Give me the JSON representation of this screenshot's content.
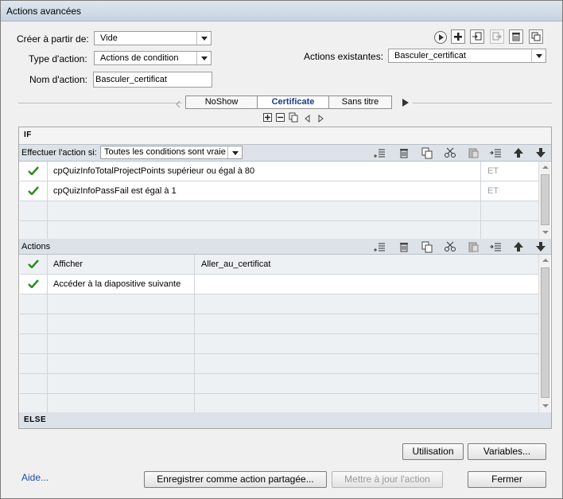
{
  "window": {
    "title": "Actions avancées"
  },
  "form": {
    "create_from_label": "Créer à partir de:",
    "create_from_value": "Vide",
    "action_type_label": "Type d'action:",
    "action_type_value": "Actions de condition",
    "action_name_label": "Nom d'action:",
    "action_name_value": "Basculer_certificat",
    "existing_label": "Actions existantes:",
    "existing_value": "Basculer_certificat"
  },
  "tabs": [
    {
      "label": "NoShow"
    },
    {
      "label": "Certificate",
      "active": true
    },
    {
      "label": "Sans titre"
    }
  ],
  "if_section": {
    "title": "IF",
    "perform_label": "Effectuer l'action si:",
    "perform_value": "Toutes les conditions sont vraie",
    "rows": [
      {
        "checked": true,
        "condition": "cpQuizInfoTotalProjectPoints   supérieur ou égal à    80",
        "op": "ET"
      },
      {
        "checked": true,
        "condition": "cpQuizInfoPassFail    est égal à    1",
        "op": "ET"
      }
    ]
  },
  "actions_section": {
    "title": "Actions",
    "rows": [
      {
        "checked": true,
        "action": "Afficher",
        "target": "Aller_au_certificat"
      },
      {
        "checked": true,
        "action": "Accéder à la diapositive suivante",
        "target": ""
      }
    ]
  },
  "else_section": {
    "title": "ELSE"
  },
  "buttons": {
    "usage": "Utilisation",
    "variables": "Variables...",
    "help": "Aide...",
    "save_shared": "Enregistrer comme action partagée...",
    "update_action": "Mettre à jour l'action",
    "close": "Fermer"
  },
  "colors": {
    "accent": "#1d3a8a",
    "check": "#2e8b1e",
    "band": "#dde2e8"
  }
}
